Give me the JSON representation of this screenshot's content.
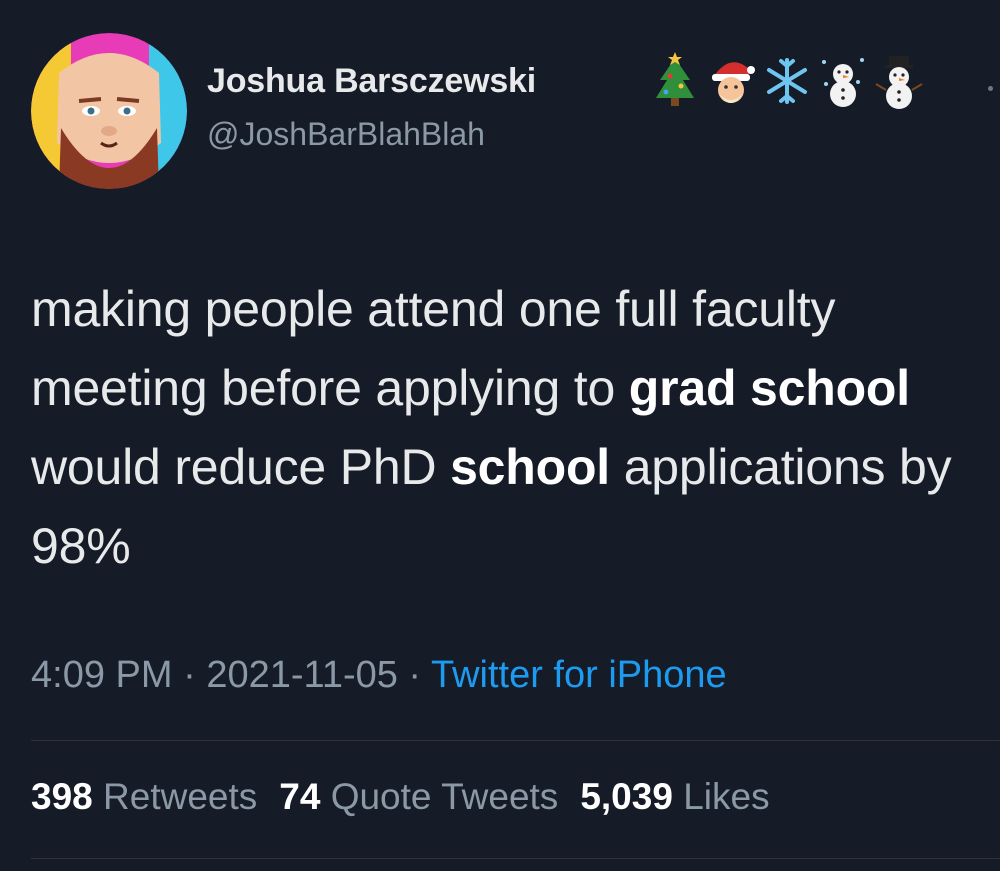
{
  "author": {
    "display_name": "Joshua Barsczewski",
    "handle": "@JoshBarBlahBlah",
    "name_emojis": [
      "christmas-tree-icon",
      "santa-icon",
      "snowflake-icon",
      "snowman-snowing-icon",
      "snowman-icon"
    ]
  },
  "tweet": {
    "text_parts": [
      "making people attend one full faculty meeting before applying to ",
      "grad school",
      " would reduce PhD ",
      "school",
      " applications by 98%"
    ]
  },
  "meta": {
    "time": "4:09 PM",
    "separator": " · ",
    "date": "2021-11-05",
    "separator2": " · ",
    "source": "Twitter for iPhone"
  },
  "stats": {
    "retweets_count": "398",
    "retweets_label": "Retweets",
    "quotes_count": "74",
    "quotes_label": "Quote Tweets",
    "likes_count": "5,039",
    "likes_label": "Likes"
  },
  "colors": {
    "background": "#151c27",
    "text": "#e7e9ea",
    "secondary": "#8b98a5",
    "link": "#1d9bf0",
    "divider": "#2f3336"
  }
}
